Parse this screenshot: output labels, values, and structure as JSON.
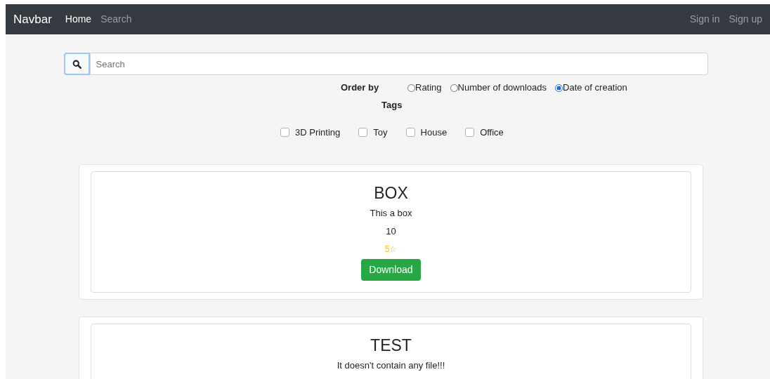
{
  "navbar": {
    "brand": "Navbar",
    "links": [
      {
        "label": "Home",
        "selected": true
      },
      {
        "label": "Search",
        "selected": false
      }
    ],
    "account_links": [
      "Sign in",
      "Sign up"
    ]
  },
  "search": {
    "placeholder": "Search"
  },
  "order_by": {
    "label": "Order by",
    "options": [
      {
        "label": "Rating",
        "selected": false
      },
      {
        "label": "Number of downloads",
        "selected": false
      },
      {
        "label": "Date of creation",
        "selected": true
      }
    ]
  },
  "tags": {
    "label": "Tags",
    "options": [
      {
        "label": "3D Printing",
        "checked": false
      },
      {
        "label": "Toy",
        "checked": false
      },
      {
        "label": "House",
        "checked": false
      },
      {
        "label": "Office",
        "checked": false
      }
    ]
  },
  "items": [
    {
      "title": "BOX",
      "description": "This a box",
      "downloads": "10",
      "rating": "5☆",
      "button": "Download"
    },
    {
      "title": "TEST",
      "description": "It doesn't contain any file!!!"
    }
  ]
}
